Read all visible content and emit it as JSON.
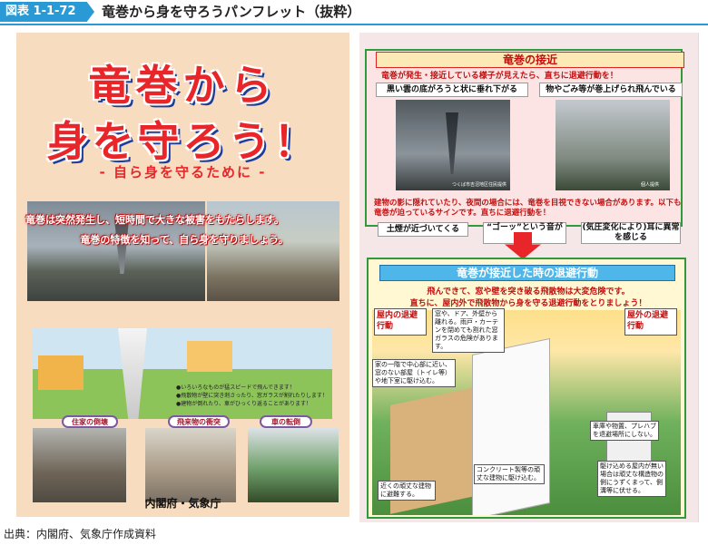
{
  "header": {
    "badge": "図表 1-1-72",
    "title": "竜巻から身を守ろうパンフレット（抜粋）"
  },
  "left_panel": {
    "headline_line1": "竜巻から",
    "headline_line2": "身を守ろう！",
    "subtitle": "- 自ら身を守るために -",
    "lead_line1": "竜巻は突然発生し、短時間で大きな被害をもたらします。",
    "lead_line2": "竜巻の特徴を知って、自ら身を守りましょう。",
    "illustration_notes": [
      "●いろいろなものが猛スピードで飛んできます！",
      "●飛散物が壁に突き刺さったり、窓ガラスが割れたりします！",
      "●建物が倒れたり、車がひっくり返ることがあります！"
    ],
    "photo_labels": [
      "住家の倒壊",
      "飛来物の衝突",
      "車の転倒"
    ],
    "credit": "内閣府・気象庁"
  },
  "right_panel": {
    "approach": {
      "title": "竜巻の接近",
      "lead": "竜巻が発生・接近している様子が見えたら、直ちに退避行動を！",
      "sign1": "黒い雲の底がろうと状に垂れ下がる",
      "sign2": "物やごみ等が巻上げられ飛んでいる",
      "photo_caption1": "つくば市吉沼地区住民提供",
      "photo_caption2": "個人提供",
      "warning": "建物の影に隠れていたり、夜間の場合には、竜巻を目視できない場合があります。以下も竜巻が迫っているサインです。直ちに退避行動を！",
      "chip1": "土煙が近づいてくる",
      "chip2": "“ゴーッ”という音がする",
      "chip3": "(気圧変化により)耳に異常を感じる"
    },
    "evacuation": {
      "title": "竜巻が接近した時の退避行動",
      "lead1": "飛んできて、窓や壁を突き破る飛散物は大変危険です。",
      "lead2": "直ちに、屋内外で飛散物から身を守る退避行動をとりましょう！",
      "indoor": "屋内の退避行動",
      "outdoor": "屋外の退避行動",
      "callout1": "窓や、ドア、外壁から離れる。雨戸・カーテンを閉めても割れた窓ガラスの危険があります。",
      "callout2": "家の一階で中心部に近い、窓のない部屋（トイレ等）や地下室に駆け込む。",
      "callout3": "車庫や物置、プレハブを退避場所にしない。",
      "callout4": "駆け込める屋内が無い場合は頑丈な構造物の側にうずくまって、側溝等に伏せる。",
      "callout5": "近くの頑丈な建物に避難する。",
      "callout6": "コンクリート製等の頑丈な建物に駆け込む。"
    }
  },
  "footer": {
    "source": "出典：内閣府、気象庁作成資料"
  }
}
